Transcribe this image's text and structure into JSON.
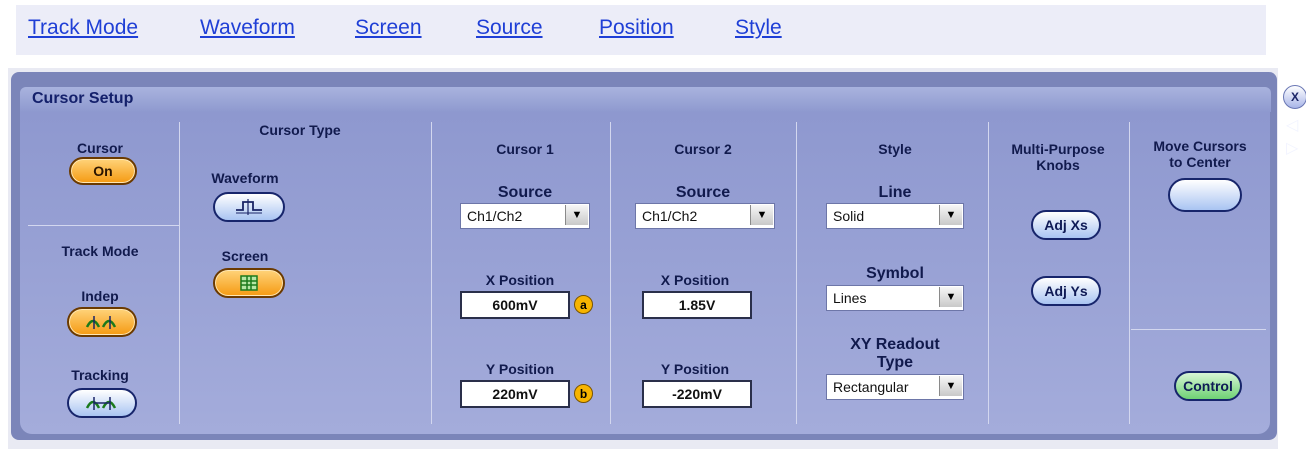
{
  "links": [
    "Track Mode",
    "Waveform",
    "Screen",
    "Source",
    "Position",
    "Style"
  ],
  "panel": {
    "title": "Cursor Setup"
  },
  "cursor": {
    "label": "Cursor",
    "button": "On"
  },
  "track_mode": {
    "label": "Track Mode",
    "indep": "Indep",
    "tracking": "Tracking"
  },
  "cursor_type": {
    "label": "Cursor Type",
    "waveform": "Waveform",
    "screen": "Screen"
  },
  "cursor1": {
    "heading": "Cursor 1",
    "source_label": "Source",
    "source_value": "Ch1/Ch2",
    "xpos_label": "X Position",
    "xpos_value": "600mV",
    "xpos_badge": "a",
    "ypos_label": "Y Position",
    "ypos_value": "220mV",
    "ypos_badge": "b"
  },
  "cursor2": {
    "heading": "Cursor 2",
    "source_label": "Source",
    "source_value": "Ch1/Ch2",
    "xpos_label": "X Position",
    "xpos_value": "1.85V",
    "ypos_label": "Y Position",
    "ypos_value": "-220mV"
  },
  "style": {
    "heading": "Style",
    "line_label": "Line",
    "line_value": "Solid",
    "symbol_label": "Symbol",
    "symbol_value": "Lines",
    "xy_label_1": "XY Readout",
    "xy_label_2": "Type",
    "xy_value": "Rectangular"
  },
  "knobs": {
    "heading_1": "Multi-Purpose",
    "heading_2": "Knobs",
    "adj_xs": "Adj Xs",
    "adj_ys": "Adj Ys"
  },
  "move": {
    "heading_1": "Move Cursors",
    "heading_2": "to Center",
    "control": "Control"
  },
  "window_controls": {
    "close": "X",
    "prev": "◁",
    "next": "▷"
  },
  "colors": {
    "link": "#1f3fd6",
    "panel": "#8e98cf",
    "accent_orange": "#f59a12"
  }
}
